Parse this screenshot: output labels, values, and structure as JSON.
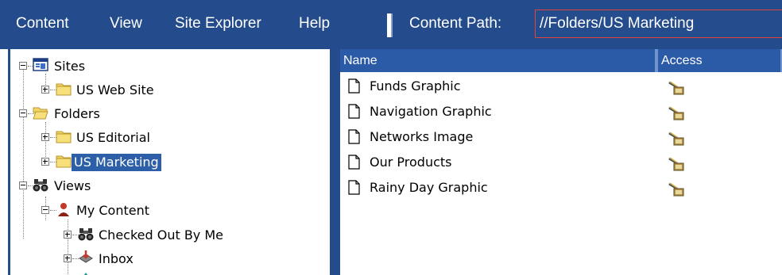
{
  "menu": {
    "items": [
      "Content",
      "View",
      "Site Explorer",
      "Help"
    ]
  },
  "content_path": {
    "label": "Content Path:",
    "value": "//Folders/US Marketing"
  },
  "tree": [
    {
      "label": "Sites",
      "icon": "sites-icon",
      "expander": "minus",
      "selected": false
    },
    {
      "label": "US Web Site",
      "icon": "folder-icon",
      "expander": "plus",
      "selected": false
    },
    {
      "label": "Folders",
      "icon": "open-folder-icon",
      "expander": "minus",
      "selected": false
    },
    {
      "label": "US Editorial",
      "icon": "folder-icon",
      "expander": "plus",
      "selected": false
    },
    {
      "label": "US Marketing",
      "icon": "folder-icon",
      "expander": "plus",
      "selected": true
    },
    {
      "label": "Views",
      "icon": "binoculars-icon",
      "expander": "minus",
      "selected": false
    },
    {
      "label": "My Content",
      "icon": "user-icon",
      "expander": "minus",
      "selected": false
    },
    {
      "label": "Checked Out By Me",
      "icon": "binoculars-icon",
      "expander": "plus",
      "selected": false
    },
    {
      "label": "Inbox",
      "icon": "inbox-icon",
      "expander": "plus",
      "selected": false
    }
  ],
  "list": {
    "columns": [
      "Name",
      "Access"
    ],
    "rows": [
      {
        "name": "Funds Graphic",
        "icon": "document-icon",
        "access_icon": "access-key-icon"
      },
      {
        "name": "Navigation Graphic",
        "icon": "document-icon",
        "access_icon": "access-key-icon"
      },
      {
        "name": "Networks Image",
        "icon": "document-icon",
        "access_icon": "access-key-icon"
      },
      {
        "name": "Our Products",
        "icon": "document-icon",
        "access_icon": "access-key-icon"
      },
      {
        "name": "Rainy Day Graphic",
        "icon": "document-icon",
        "access_icon": "access-key-icon"
      }
    ]
  },
  "colors": {
    "menubar_bg": "#244c8c",
    "header_bg": "#2b5aa6",
    "selection_bg": "#2c5fa8",
    "path_border": "#e2433b"
  }
}
